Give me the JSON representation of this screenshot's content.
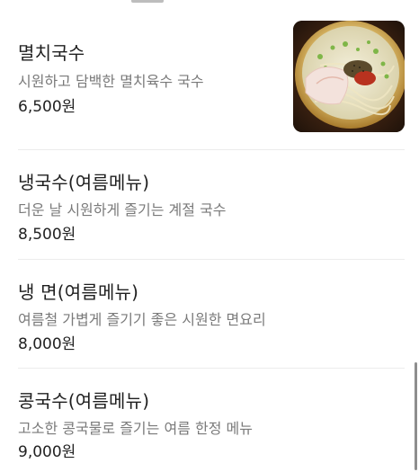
{
  "menu": {
    "items": [
      {
        "name": "멸치국수",
        "description": "시원하고 담백한 멸치육수 국수",
        "price": "6,500원",
        "image": "noodle-soup-photo"
      },
      {
        "name": "냉국수(여름메뉴)",
        "description": "더운 날 시원하게 즐기는 계절 국수",
        "price": "8,500원"
      },
      {
        "name": "냉 면(여름메뉴)",
        "description": "여름철 가볍게 즐기기 좋은 시원한 면요리",
        "price": "8,000원"
      },
      {
        "name": "콩국수(여름메뉴)",
        "description": "고소한 콩국물로 즐기는 여름 한정 메뉴",
        "price": "9,000원"
      }
    ]
  },
  "colors": {
    "background": "#ffffff",
    "name_text": "#1f1f1f",
    "description_text": "#7a7a7a",
    "price_text": "#222222",
    "divider": "#ececec"
  }
}
